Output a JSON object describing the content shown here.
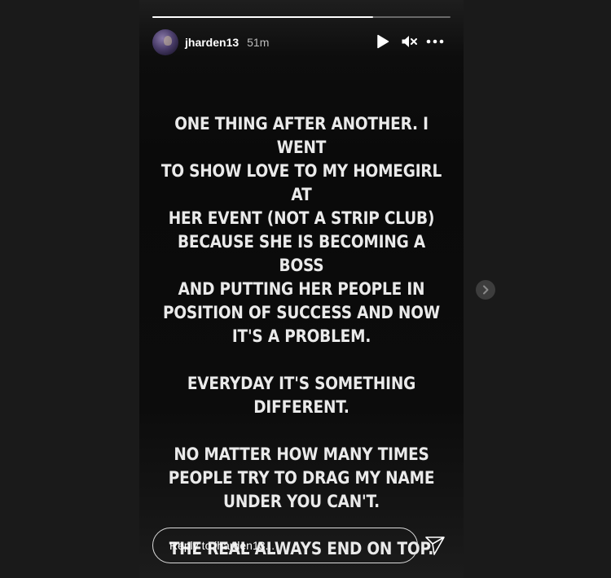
{
  "story": {
    "progress_fraction": 0.74,
    "header": {
      "username": "jharden13",
      "time": "51m"
    },
    "icons": {
      "play": "play-icon",
      "mute": "muted-speaker-icon",
      "more": "more-options-icon"
    },
    "text_blocks": [
      "ONE THING AFTER ANOTHER. I WENT\nTO SHOW LOVE TO MY HOMEGIRL AT\nHER EVENT (NOT A STRIP CLUB)\nBECAUSE SHE IS BECOMING A BOSS\nAND PUTTING HER PEOPLE IN\nPOSITION OF SUCCESS AND NOW\nIT'S A PROBLEM.",
      "EVERYDAY IT'S SOMETHING\nDIFFERENT.",
      "NO MATTER HOW MANY TIMES\nPEOPLE TRY TO DRAG MY NAME\nUNDER YOU CAN'T.",
      "THE REAL ALWAYS END ON TOP."
    ],
    "reply": {
      "placeholder": "Reply to jharden13..."
    }
  },
  "navigation": {
    "next_icon": "chevron-right-icon"
  },
  "colors": {
    "page_background": "#1a1a1a",
    "story_background": "#0a0a0a",
    "text": "#eaeaea",
    "next_button": "#3d3d3d"
  }
}
